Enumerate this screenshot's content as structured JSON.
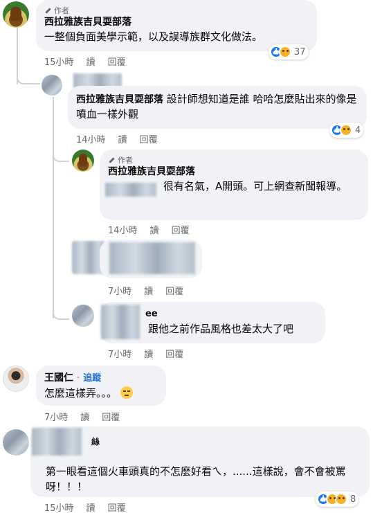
{
  "comments": [
    {
      "author_tag": "作者",
      "name": "西拉雅族吉貝耍部落",
      "text": "一整個負面美學示範，以及誤導族群文化做法。",
      "time": "15小時",
      "reply": "讀",
      "respond": "回覆",
      "reaction_count": "37"
    },
    {
      "name": "西拉雅族吉貝耍部落",
      "text": "設計師想知道是誰 哈哈怎麼貼出來的像是噴血一樣外觀",
      "time": "14小時",
      "reply": "讀",
      "respond": "回覆",
      "reaction_count": "4"
    },
    {
      "author_tag": "作者",
      "name": "西拉雅族吉貝耍部落",
      "text": "很有名氣，A開頭。可上網查新聞報導。",
      "time": "14小時",
      "reply": "讀",
      "respond": "回覆"
    },
    {
      "time": "7小時",
      "reply": "讀",
      "respond": "回覆"
    },
    {
      "name_fragment": "ee",
      "text": "跟他之前作品風格也差太大了吧",
      "time": "7小時",
      "reply": "讀",
      "respond": "回覆"
    },
    {
      "name": "王國仁",
      "dot": "·",
      "follow": "追蹤",
      "text": "怎麼這樣弄。。。",
      "time": "7小時",
      "reply": "讀",
      "respond": "回覆"
    },
    {
      "name_fragment": "絲",
      "text": "第一眼看這個火車頭真的不怎麼好看ㄟ，......這樣說，會不會被罵呀！！！",
      "time": "15小時",
      "reply": "讀",
      "respond": "回覆",
      "reaction_count": "8"
    }
  ]
}
